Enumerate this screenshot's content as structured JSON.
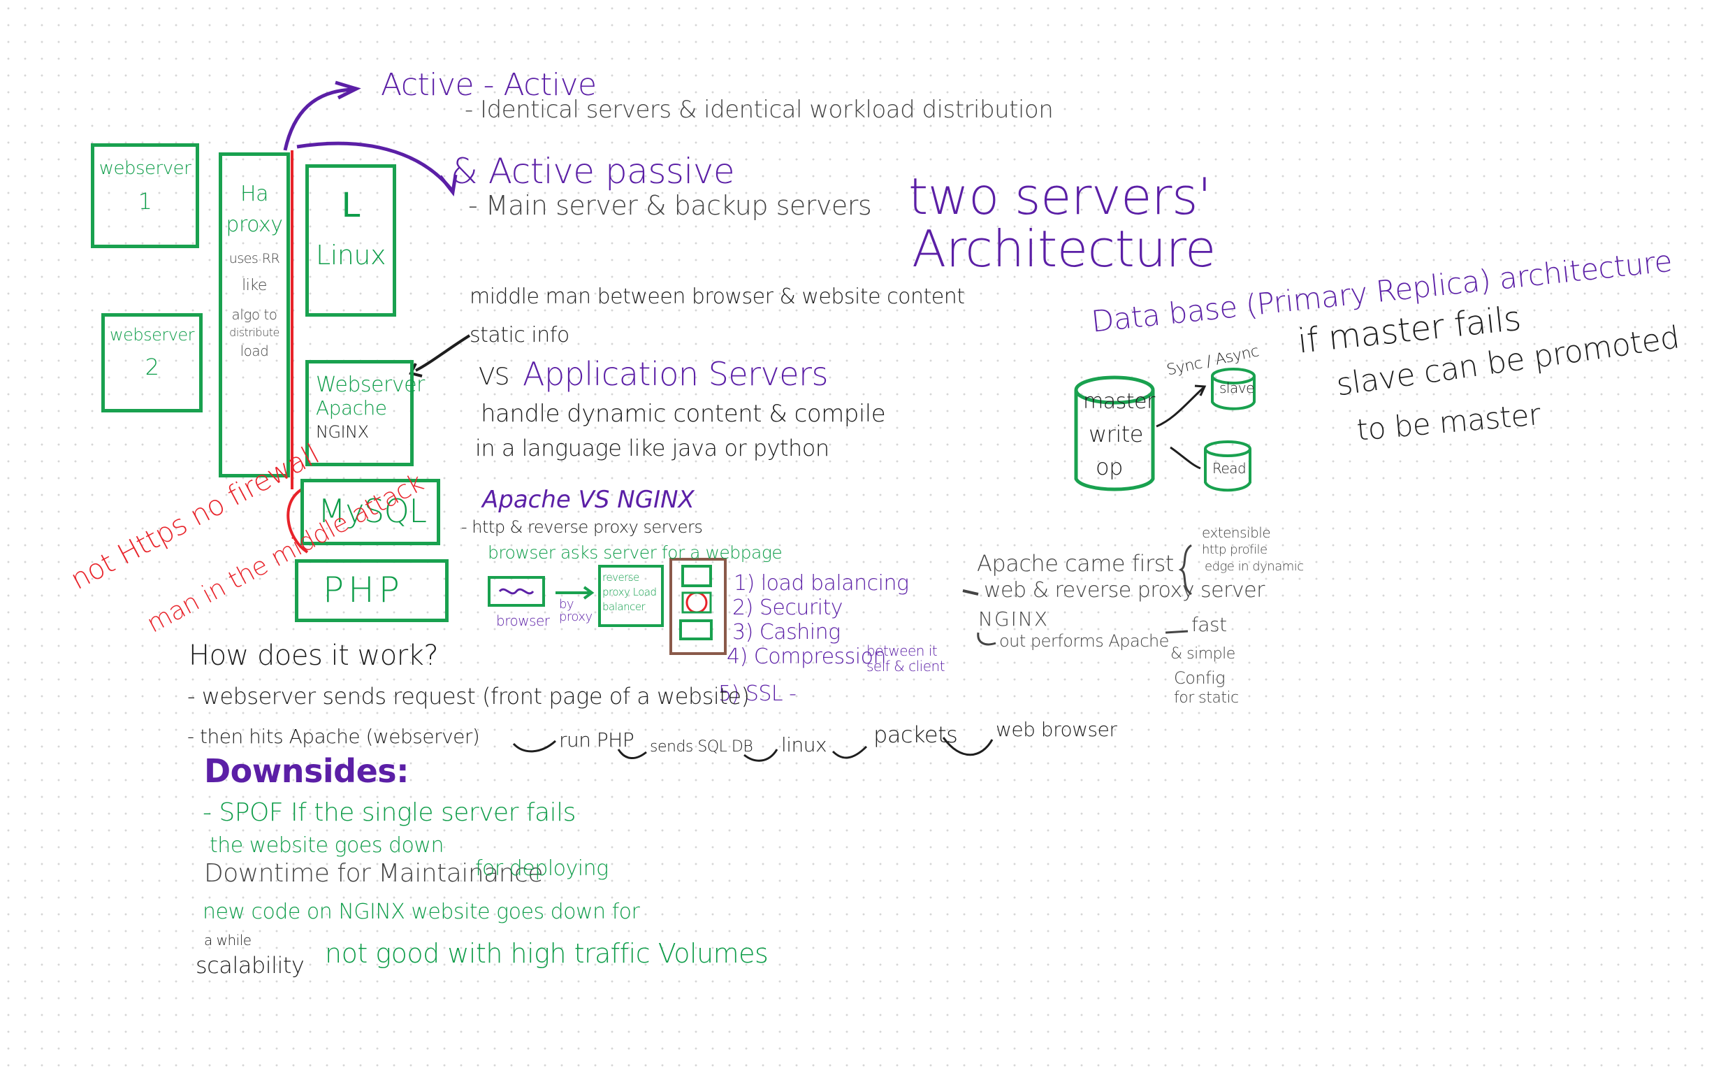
{
  "colors": {
    "purple": "#5b1fa6",
    "green": "#19a14f",
    "red": "#e8232a",
    "black": "#1e1e1e",
    "brown": "#8a5a4a"
  },
  "top": {
    "active_active": "Active - Active",
    "active_active_desc": "- Identical servers & identical workload distribution",
    "active_passive": "& Active passive",
    "active_passive_desc": "- Main server & backup servers",
    "title_line1": "two servers'",
    "title_line2": "Architecture"
  },
  "left_stack": {
    "webserver1": [
      "webserver",
      "1"
    ],
    "webserver2": [
      "webserver",
      "2"
    ],
    "haproxy": [
      "Ha",
      "proxy",
      "uses RR",
      "like",
      "algo to",
      "distribute",
      "load"
    ],
    "linux_letter": "L",
    "linux_label": "Linux",
    "webserver_box": [
      "Webserver",
      "Apache",
      "NGINX"
    ],
    "mysql": "MySQL",
    "php": "PHP",
    "red_note_1": "not Https no firewall",
    "red_note_2": "man in the middle attack"
  },
  "middle": {
    "middle_man": "middle man between browser & website content",
    "static_info": "static info",
    "vs": "VS",
    "app_servers": "Application Servers",
    "app_desc_1": "handle dynamic content & compile",
    "app_desc_2": "in a language like java or python",
    "apache_vs_nginx": "Apache VS NGINX",
    "http_proxy": "- http & reverse proxy servers",
    "browser_asks": "browser asks server for a webpage",
    "browser_label": "browser",
    "by_proxy": "by proxy",
    "reverse_proxy_box": "reverse proxy Load balancer",
    "benefits": [
      "1) load balancing",
      "2) Security",
      "3) Cashing",
      "4) Compression",
      "5) SSL -"
    ],
    "between_note": "between it self & client"
  },
  "how": {
    "question": "How does it work?",
    "step1": "- webserver sends request (front page of a website)",
    "step2_a": "- then hits Apache (webserver)",
    "step2_b": "run PHP",
    "step2_c": "sends SQL DB",
    "step2_d": "linux",
    "step2_e": "packets",
    "step2_f": "web browser"
  },
  "downsides": {
    "title": "Downsides:",
    "l1": "- SPOF If the single server fails",
    "l2": "the website goes down",
    "l3a": "Downtime for Maintainance",
    "l3b": "for deploying",
    "l4": "new code on NGINX website goes down for",
    "l5": "a while",
    "l6a": "scalability",
    "l6b": "not good with high traffic Volumes"
  },
  "db": {
    "title": "Data base (Primary Replica) architecture",
    "master": [
      "master",
      "write",
      "op"
    ],
    "sync": "Sync / Async",
    "slave": "slave",
    "read": "Read",
    "failover_1": "if master fails",
    "failover_2": "slave can be promoted",
    "failover_3": "to be master"
  },
  "apache_note": {
    "line1": "Apache came first",
    "extensible": "extensible",
    "http_profile": "http profile",
    "edge": "edge in dynamic",
    "line2": "web & reverse proxy server",
    "nginx": "NGINX",
    "outperforms": "out performs Apache",
    "fast": "fast",
    "simple": "& simple",
    "config": "Config",
    "for_static": "for static"
  }
}
